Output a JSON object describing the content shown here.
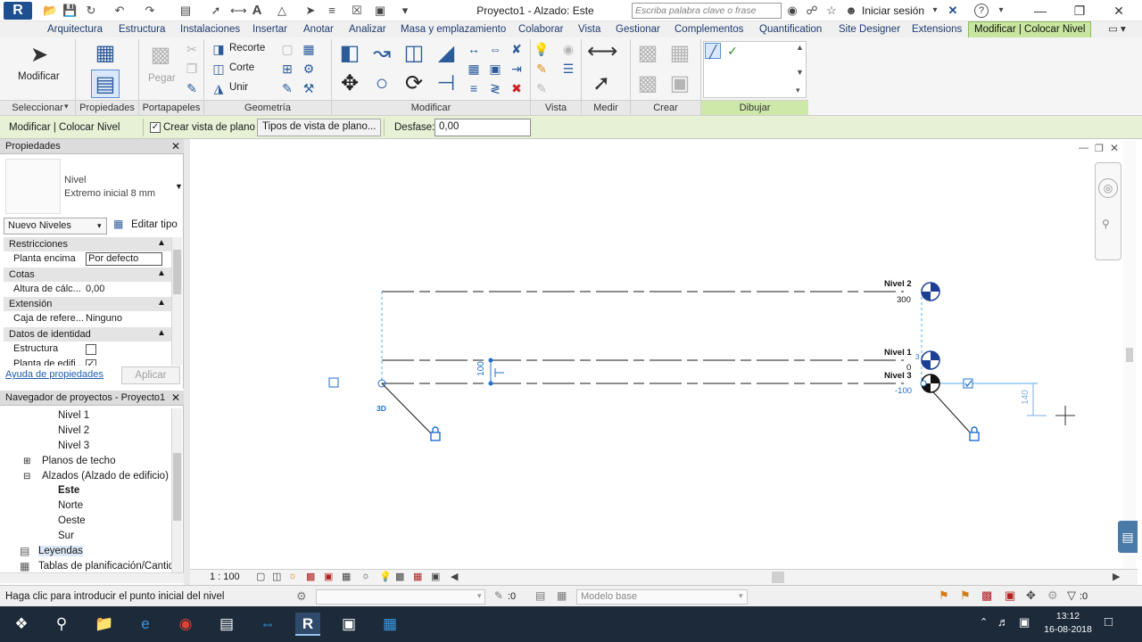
{
  "window": {
    "title": "Proyecto1 - Alzado: Este",
    "app_letter": "R",
    "search_placeholder": "Escriba palabra clave o frase",
    "login_label": "Iniciar sesión",
    "help_label": "?"
  },
  "tabs": [
    {
      "label": "Arquitectura"
    },
    {
      "label": "Estructura"
    },
    {
      "label": "Instalaciones"
    },
    {
      "label": "Insertar"
    },
    {
      "label": "Anotar"
    },
    {
      "label": "Analizar"
    },
    {
      "label": "Masa y emplazamiento"
    },
    {
      "label": "Colaborar"
    },
    {
      "label": "Vista"
    },
    {
      "label": "Gestionar"
    },
    {
      "label": "Complementos"
    },
    {
      "label": "Quantification"
    },
    {
      "label": "Site Designer"
    },
    {
      "label": "Extensions"
    },
    {
      "label": "Modificar | Colocar Nivel",
      "active": true
    }
  ],
  "ribbon": {
    "modify_label": "Modificar",
    "paste_label": "Pegar",
    "recorte_label": "Recorte",
    "corte_label": "Corte",
    "unir_label": "Unir",
    "panels": [
      {
        "label": "Seleccionar"
      },
      {
        "label": "Propiedades"
      },
      {
        "label": "Portapapeles"
      },
      {
        "label": "Geometría"
      },
      {
        "label": "Modificar"
      },
      {
        "label": "Vista"
      },
      {
        "label": "Medir"
      },
      {
        "label": "Crear"
      },
      {
        "label": "Dibujar"
      }
    ]
  },
  "options_bar": {
    "context_label": "Modificar | Colocar Nivel",
    "create_view_label": "Crear vista de plano",
    "create_view_checked": true,
    "view_types_button": "Tipos de vista de plano...",
    "offset_label": "Desfase:",
    "offset_value": "0,00"
  },
  "properties": {
    "header": "Propiedades",
    "type_family": "Nivel",
    "type_name": "Extremo inicial 8 mm",
    "instance_selector": "Nuevo Niveles",
    "edit_type_label": "Editar tipo",
    "sections": [
      {
        "title": "Restricciones",
        "rows": [
          {
            "name": "Planta encima",
            "value": "Por defecto"
          }
        ]
      },
      {
        "title": "Cotas",
        "rows": [
          {
            "name": "Altura de cálc...",
            "value": "0,00"
          }
        ]
      },
      {
        "title": "Extensión",
        "rows": [
          {
            "name": "Caja de refere...",
            "value": "Ninguno"
          }
        ]
      },
      {
        "title": "Datos de identidad",
        "rows": [
          {
            "name": "Estructura",
            "value": ""
          },
          {
            "name": "Planta de edifi...",
            "value": ""
          }
        ]
      }
    ],
    "help_link": "Ayuda de propiedades",
    "apply_label": "Aplicar"
  },
  "browser": {
    "header": "Navegador de proyectos - Proyecto1",
    "items": [
      {
        "label": "Nivel 1"
      },
      {
        "label": "Nivel 2"
      },
      {
        "label": "Nivel 3"
      },
      {
        "label": "Planos de techo"
      },
      {
        "label": "Alzados (Alzado de edificio)"
      },
      {
        "label": "Este",
        "bold": true
      },
      {
        "label": "Norte"
      },
      {
        "label": "Oeste"
      },
      {
        "label": "Sur"
      },
      {
        "label": "Leyendas"
      },
      {
        "label": "Tablas de planificación/Cantid"
      }
    ]
  },
  "canvas": {
    "levels": [
      {
        "name": "Nivel 2",
        "elevation": "300"
      },
      {
        "name": "Nivel 1",
        "elevation": "0"
      },
      {
        "name": "Nivel 3",
        "elevation": "-100"
      }
    ],
    "dim_temp_1": "100",
    "dim_temp_2": "140",
    "label_3d": "3D",
    "level1_marker_digit": "3"
  },
  "view_bar": {
    "scale": "1 : 100"
  },
  "status": {
    "message": "Haga clic para introducir el punto inicial del nivel",
    "workset_count": ":0",
    "model": "Modelo base",
    "filter_count": ":0"
  },
  "taskbar": {
    "time": "13:12",
    "date": "16-08-2018"
  },
  "colors": {
    "active_tab": "#c8e6a0",
    "options_bar": "#e6f1d6",
    "level_line": "#1a1a1a",
    "selection_blue": "#1f6fd1",
    "level_marker": "#1c3f94"
  }
}
